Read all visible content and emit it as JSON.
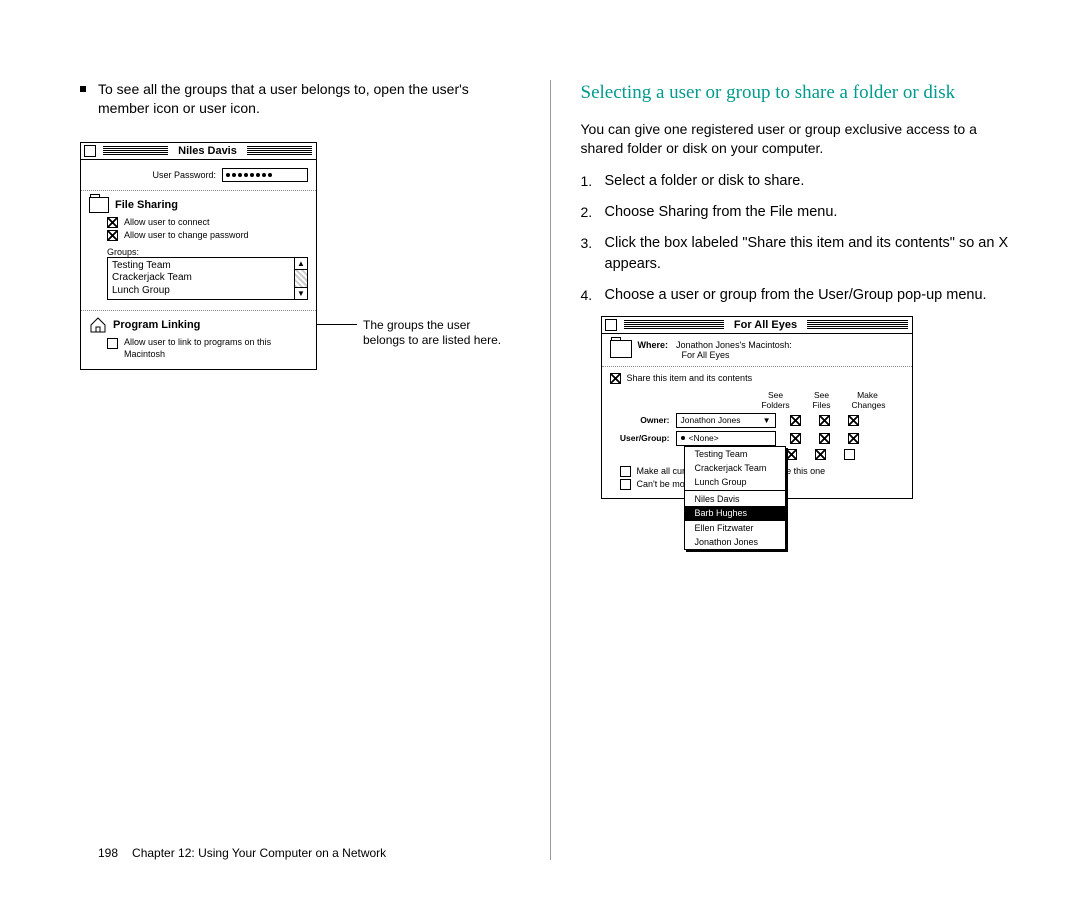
{
  "left": {
    "bullet_text": "To see all the groups that a user belongs to, open the user's member icon or user icon.",
    "win": {
      "title": "Niles Davis",
      "pw_label": "User Password:",
      "file_sharing": "File Sharing",
      "allow_connect": "Allow user to connect",
      "allow_change_pw": "Allow user to change password",
      "groups_label": "Groups:",
      "groups": [
        "Testing Team",
        "Crackerjack Team",
        "Lunch Group"
      ],
      "program_linking": "Program Linking",
      "allow_link": "Allow user to link to programs on this Macintosh"
    },
    "caption1": "The groups the user",
    "caption2": "belongs to are listed here."
  },
  "right": {
    "heading": "Selecting a user or group to share a folder or disk",
    "intro": "You can give one registered user or group exclusive access to a shared folder or disk on your computer.",
    "steps": [
      "Select a folder or disk to share.",
      "Choose Sharing from the File menu.",
      "Click the box labeled \"Share this item and its contents\" so an X appears.",
      "Choose a user or group from the User/Group pop-up menu."
    ],
    "sharewin": {
      "title": "For All Eyes",
      "where_label": "Where:",
      "where1": "Jonathon Jones's Macintosh:",
      "where2": "For All Eyes",
      "share_cb": "Share this item and its contents",
      "hdr": [
        "See Folders",
        "See Files",
        "Make Changes"
      ],
      "owner_label": "Owner:",
      "owner_value": "Jonathon Jones",
      "ug_label": "User/Group:",
      "ug_value": "<None>",
      "make_all": "Make all currently enclosed folders like this one",
      "cant_move": "Can't be moved, renamed or deleted",
      "popup": {
        "groups": [
          "Testing Team",
          "Crackerjack Team",
          "Lunch Group"
        ],
        "users": [
          "Niles Davis",
          "Barb Hughes",
          "Ellen Fitzwater",
          "Jonathon Jones"
        ],
        "selected": "Barb Hughes"
      }
    }
  },
  "footer": {
    "page": "198",
    "chapter": "Chapter 12: Using Your Computer on a Network"
  }
}
